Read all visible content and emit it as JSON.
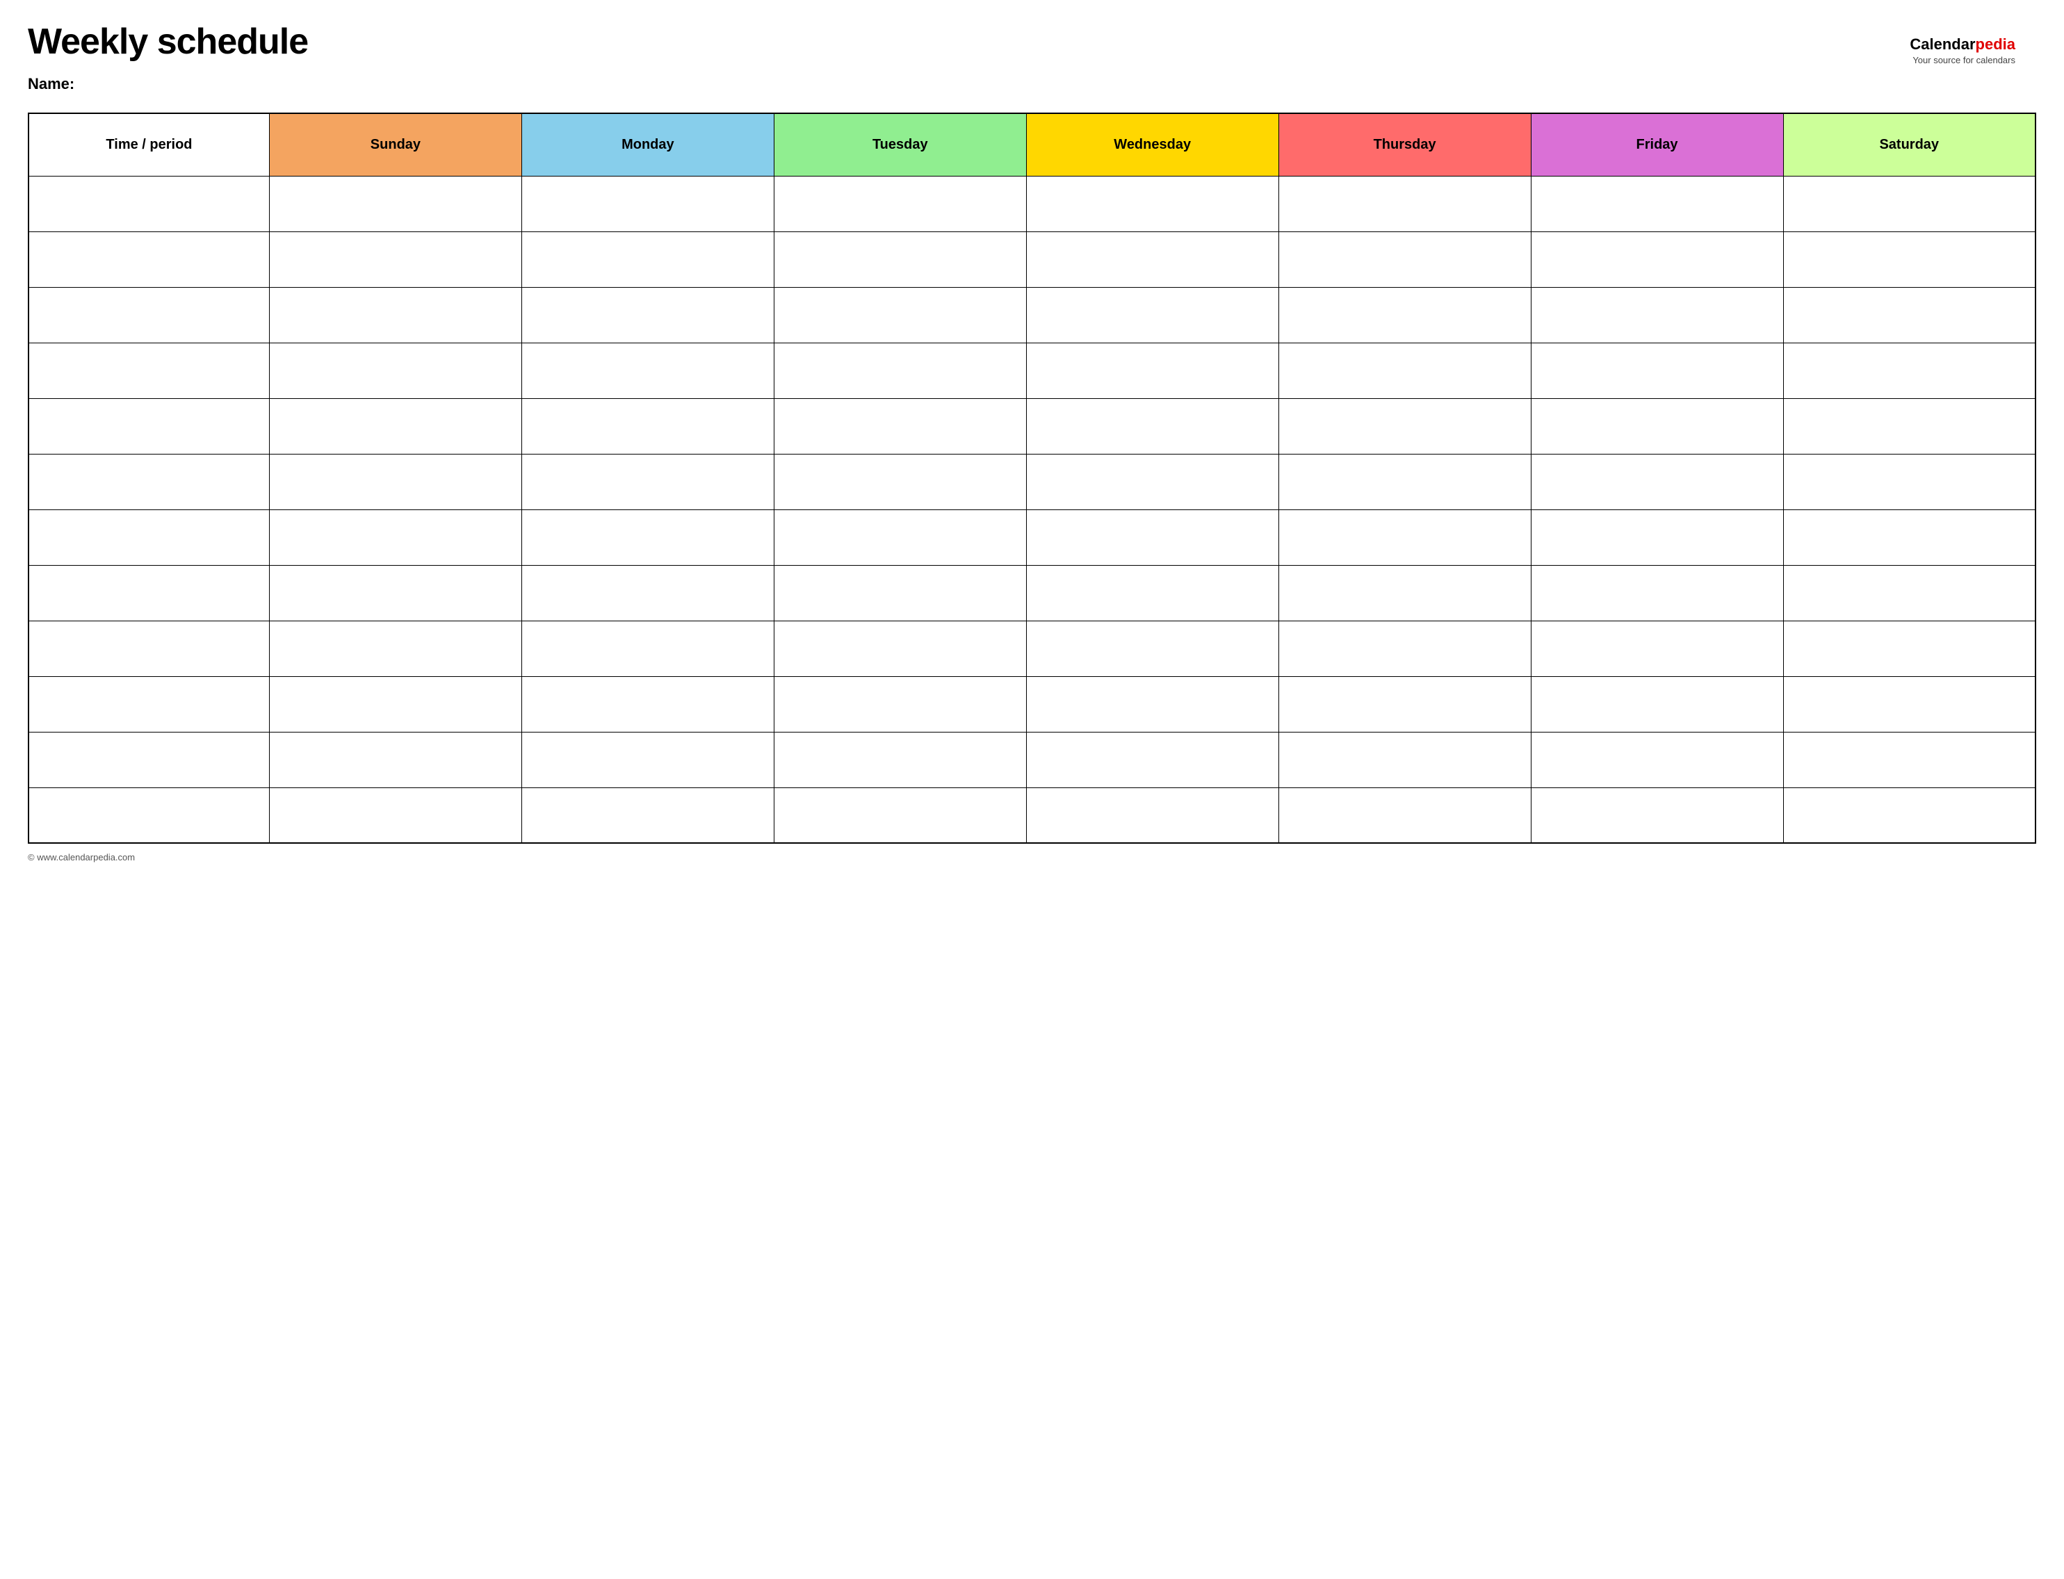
{
  "page": {
    "title": "Weekly schedule",
    "name_label": "Name:",
    "footer_text": "© www.calendarpedia.com"
  },
  "logo": {
    "brand_start": "Calendar",
    "brand_end": "pedia",
    "tagline": "Your source for calendars"
  },
  "table": {
    "headers": [
      {
        "id": "time",
        "label": "Time / period",
        "color": "#ffffff",
        "text_color": "#000000"
      },
      {
        "id": "sunday",
        "label": "Sunday",
        "color": "#f4a460",
        "text_color": "#000000"
      },
      {
        "id": "monday",
        "label": "Monday",
        "color": "#87ceeb",
        "text_color": "#000000"
      },
      {
        "id": "tuesday",
        "label": "Tuesday",
        "color": "#90ee90",
        "text_color": "#000000"
      },
      {
        "id": "wednesday",
        "label": "Wednesday",
        "color": "#ffd700",
        "text_color": "#000000"
      },
      {
        "id": "thursday",
        "label": "Thursday",
        "color": "#ff6b6b",
        "text_color": "#000000"
      },
      {
        "id": "friday",
        "label": "Friday",
        "color": "#da70d6",
        "text_color": "#000000"
      },
      {
        "id": "saturday",
        "label": "Saturday",
        "color": "#ccff99",
        "text_color": "#000000"
      }
    ],
    "row_count": 12
  }
}
